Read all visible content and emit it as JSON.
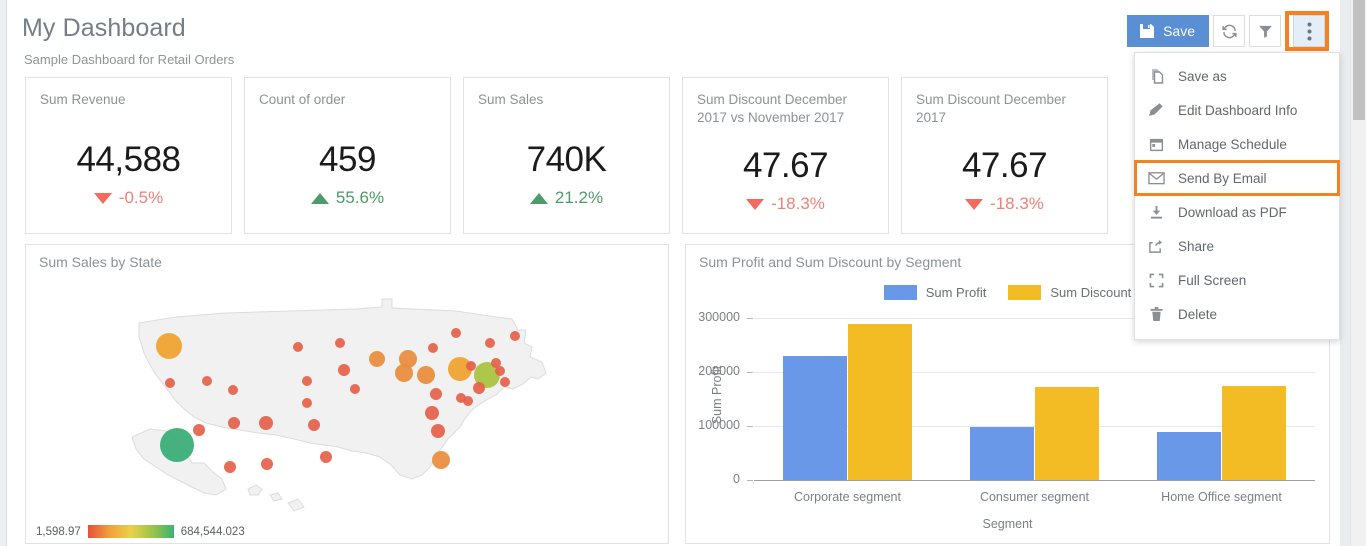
{
  "header": {
    "title": "My Dashboard",
    "subtitle": "Sample Dashboard for Retail Orders"
  },
  "toolbar": {
    "save_label": "Save",
    "save_icon": "floppy-disk-icon",
    "refresh_icon": "refresh-icon",
    "filter_icon": "filter-icon",
    "more_icon": "vertical-dots-icon",
    "save_bg_color": "#5B8FD4",
    "highlight_color": "#F58220"
  },
  "menu": {
    "items": [
      {
        "label": "Save as",
        "icon": "copy-page-icon"
      },
      {
        "label": "Edit Dashboard Info",
        "icon": "pencil-icon"
      },
      {
        "label": "Manage Schedule",
        "icon": "calendar-icon"
      },
      {
        "label": "Send By Email",
        "icon": "envelope-icon",
        "highlighted": true
      },
      {
        "label": "Download as PDF",
        "icon": "download-icon"
      },
      {
        "label": "Share",
        "icon": "share-icon"
      },
      {
        "label": "Full Screen",
        "icon": "fullscreen-icon"
      },
      {
        "label": "Delete",
        "icon": "trash-icon"
      }
    ]
  },
  "kpis": [
    {
      "title": "Sum Revenue",
      "value": "44,588",
      "delta": "-0.5%",
      "direction": "down",
      "two_line": false
    },
    {
      "title": "Count of order",
      "value": "459",
      "delta": "55.6%",
      "direction": "up",
      "two_line": false
    },
    {
      "title": "Sum Sales",
      "value": "740K",
      "delta": "21.2%",
      "direction": "up",
      "two_line": false
    },
    {
      "title": "Sum Discount December 2017 vs November 2017",
      "value": "47.67",
      "delta": "-18.3%",
      "direction": "down",
      "two_line": true
    },
    {
      "title": "Sum Discount December 2017",
      "value": "47.67",
      "delta": "-18.3%",
      "direction": "down",
      "two_line": true
    }
  ],
  "colors": {
    "up": "#4E9A69",
    "down": "#EF8178",
    "sum_profit": "#6A98E8",
    "sum_discount": "#F4BC24"
  },
  "map_panel": {
    "title": "Sum Sales by State",
    "legend_min": "1,598.97",
    "legend_max": "684,544.023"
  },
  "chart_data": {
    "type": "bar",
    "title": "Sum Profit and Sum Discount by Segment",
    "xlabel": "Segment",
    "ylabel": "Sum Profit",
    "categories": [
      "Corporate segment",
      "Consumer segment",
      "Home Office segment"
    ],
    "series": [
      {
        "name": "Sum Profit",
        "color": "#6A98E8",
        "values": [
          230000,
          98000,
          88000
        ]
      },
      {
        "name": "Sum Discount",
        "color": "#F4BC24",
        "values": [
          288000,
          172000,
          173000
        ]
      }
    ],
    "yticks": [
      0,
      100000,
      200000,
      300000
    ],
    "ylim": [
      0,
      320000
    ],
    "grid": true,
    "legend_position": "top"
  }
}
